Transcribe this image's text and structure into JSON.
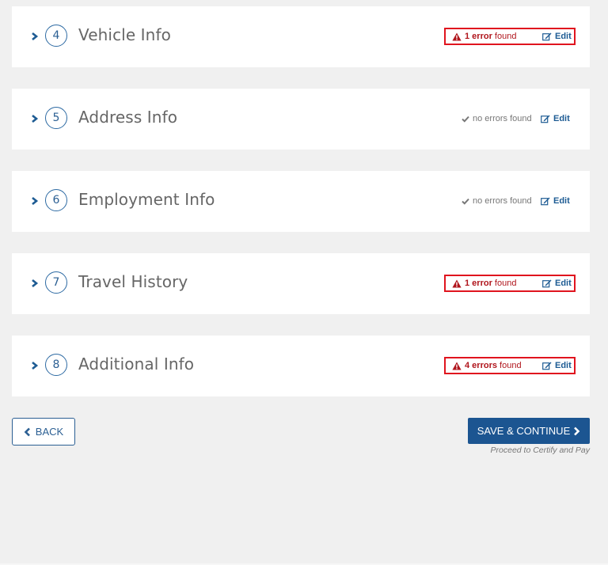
{
  "sections": [
    {
      "number": "4",
      "title": "Vehicle Info",
      "status": "error",
      "status_count": "1 error",
      "status_suffix": "found",
      "edit_label": "Edit"
    },
    {
      "number": "5",
      "title": "Address Info",
      "status": "ok",
      "status_text": "no errors found",
      "edit_label": "Edit"
    },
    {
      "number": "6",
      "title": "Employment Info",
      "status": "ok",
      "status_text": "no errors found",
      "edit_label": "Edit"
    },
    {
      "number": "7",
      "title": "Travel History",
      "status": "error",
      "status_count": "1 error",
      "status_suffix": "found",
      "edit_label": "Edit"
    },
    {
      "number": "8",
      "title": "Additional Info",
      "status": "error",
      "status_count": "4 errors",
      "status_suffix": "found",
      "edit_label": "Edit"
    }
  ],
  "footer": {
    "back_label": "BACK",
    "save_label": "SAVE & CONTINUE",
    "proceed_note": "Proceed to Certify and Pay"
  },
  "colors": {
    "accent": "#1c5591",
    "error": "#e0141e",
    "error_text": "#b0151c",
    "background": "#f0f0f0"
  }
}
